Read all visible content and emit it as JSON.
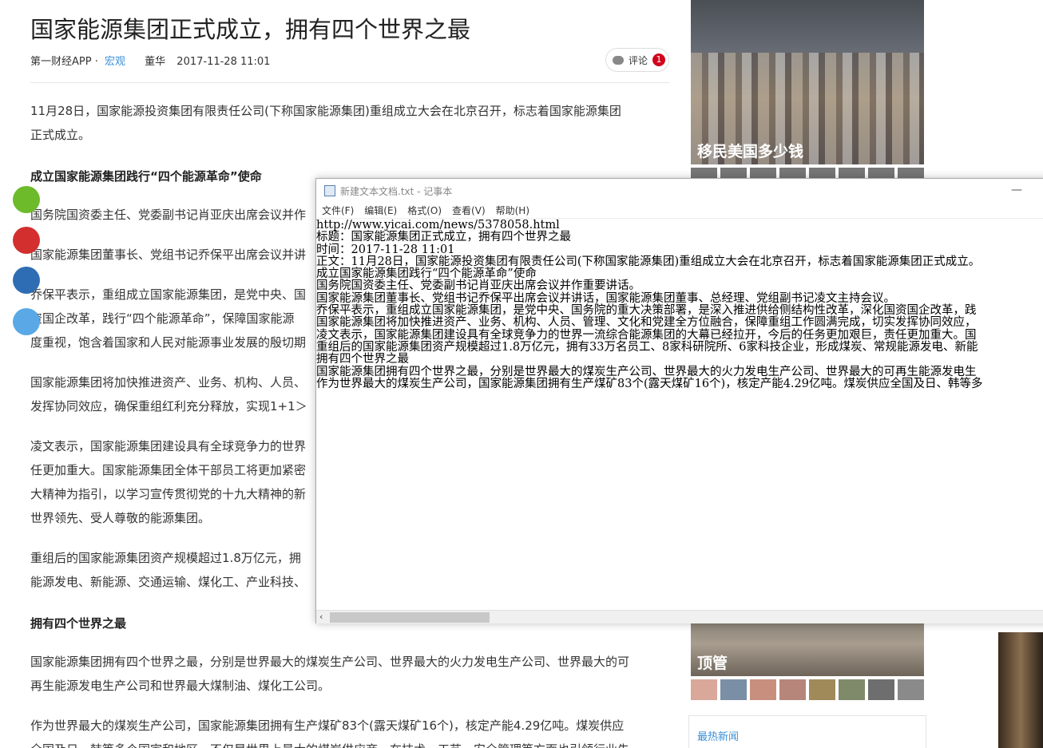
{
  "article": {
    "title": "国家能源集团正式成立，拥有四个世界之最",
    "source": "第一财经APP ·",
    "category": "宏观",
    "author": "董华",
    "date": "2017-11-28 11:01",
    "comment_label": "评论",
    "comment_count": "1",
    "p1a": "11月28日，国家能源投资集团有限责任公司(下称国家能源集团)重组成立大会在北京召开，标志着国家能源集团",
    "p1b": "正式成立。",
    "h1": "成立国家能源集团践行“四个能源革命”使命",
    "p2": "国务院国资委主任、党委副书记肖亚庆出席会议并作",
    "p3": "国家能源集团董事长、党组书记乔保平出席会议并讲",
    "p4a": "乔保平表示，重组成立国家能源集团，是党中央、国",
    "p4b": "资国企改革，践行“四个能源革命”，保障国家能源",
    "p4c": "度重视，饱含着国家和人民对能源事业发展的殷切期",
    "p5a": "国家能源集团将加快推进资产、业务、机构、人员、",
    "p5b": "发挥协同效应，确保重组红利充分释放，实现1+1＞",
    "p6a": "凌文表示，国家能源集团建设具有全球竞争力的世界",
    "p6b": "任更加重大。国家能源集团全体干部员工将更加紧密",
    "p6c": "大精神为指引，以学习宣传贯彻党的十九大精神的新",
    "p6d": "世界领先、受人尊敬的能源集团。",
    "p7a": "重组后的国家能源集团资产规模超过1.8万亿元，拥",
    "p7b": "能源发电、新能源、交通运输、煤化工、产业科技、",
    "h2": "拥有四个世界之最",
    "p8a": "国家能源集团拥有四个世界之最，分别是世界最大的煤炭生产公司、世界最大的火力发电生产公司、世界最大的可",
    "p8b": "再生能源发电生产公司和世界最大煤制油、煤化工公司。",
    "p9a": "作为世界最大的煤炭生产公司，国家能源集团拥有生产煤矿83个(露天煤矿16个)，核定产能4.29亿吨。煤炭供应",
    "p9b": "全国及日、韩等多个国家和地区，不仅是世界上最大的煤炭供应商，在技术、工艺、安全管理等方面也引领行业先"
  },
  "sidebar": {
    "top_caption": "移民美国多少钱",
    "bottom_caption": "顶管",
    "hot_news": "最热新闻"
  },
  "notepad": {
    "title": "新建文本文档.txt - 记事本",
    "minimize": "—",
    "menu": [
      "文件(F)",
      "编辑(E)",
      "格式(O)",
      "查看(V)",
      "帮助(H)"
    ],
    "lines": [
      "http://www.yicai.com/news/5378058.html",
      "标题：国家能源集团正式成立，拥有四个世界之最",
      "时间：2017-11-28 11:01",
      "正文：11月28日，国家能源投资集团有限责任公司(下称国家能源集团)重组成立大会在北京召开，标志着国家能源集团正式成立。",
      "成立国家能源集团践行“四个能源革命”使命",
      "国务院国资委主任、党委副书记肖亚庆出席会议并作重要讲话。",
      "国家能源集团董事长、党组书记乔保平出席会议并讲话，国家能源集团董事、总经理、党组副书记凌文主持会议。",
      "乔保平表示，重组成立国家能源集团，是党中央、国务院的重大决策部署，是深入推进供给侧结构性改革，深化国资国企改革，践",
      "国家能源集团将加快推进资产、业务、机构、人员、管理、文化和党建全方位融合，保障重组工作圆满完成，切实发挥协同效应，",
      "凌文表示，国家能源集团建设具有全球竞争力的世界一流综合能源集团的大幕已经拉开，今后的任务更加艰巨，责任更加重大。国",
      "重组后的国家能源集团资产规模超过1.8万亿元，拥有33万名员工、8家科研院所、6家科技企业，形成煤炭、常规能源发电、新能",
      "拥有四个世界之最",
      "国家能源集团拥有四个世界之最，分别是世界最大的煤炭生产公司、世界最大的火力发电生产公司、世界最大的可再生能源发电生",
      "作为世界最大的煤炭生产公司，国家能源集团拥有生产煤矿83个(露天煤矿16个)，核定产能4.29亿吨。煤炭供应全国及日、韩等多"
    ]
  },
  "colors": {
    "link_blue": "#3a8fd6",
    "badge_red": "#d0021b",
    "social": [
      "#6dbb2b",
      "#d32f2f",
      "#2e6db4",
      "#5aa9e6"
    ]
  }
}
